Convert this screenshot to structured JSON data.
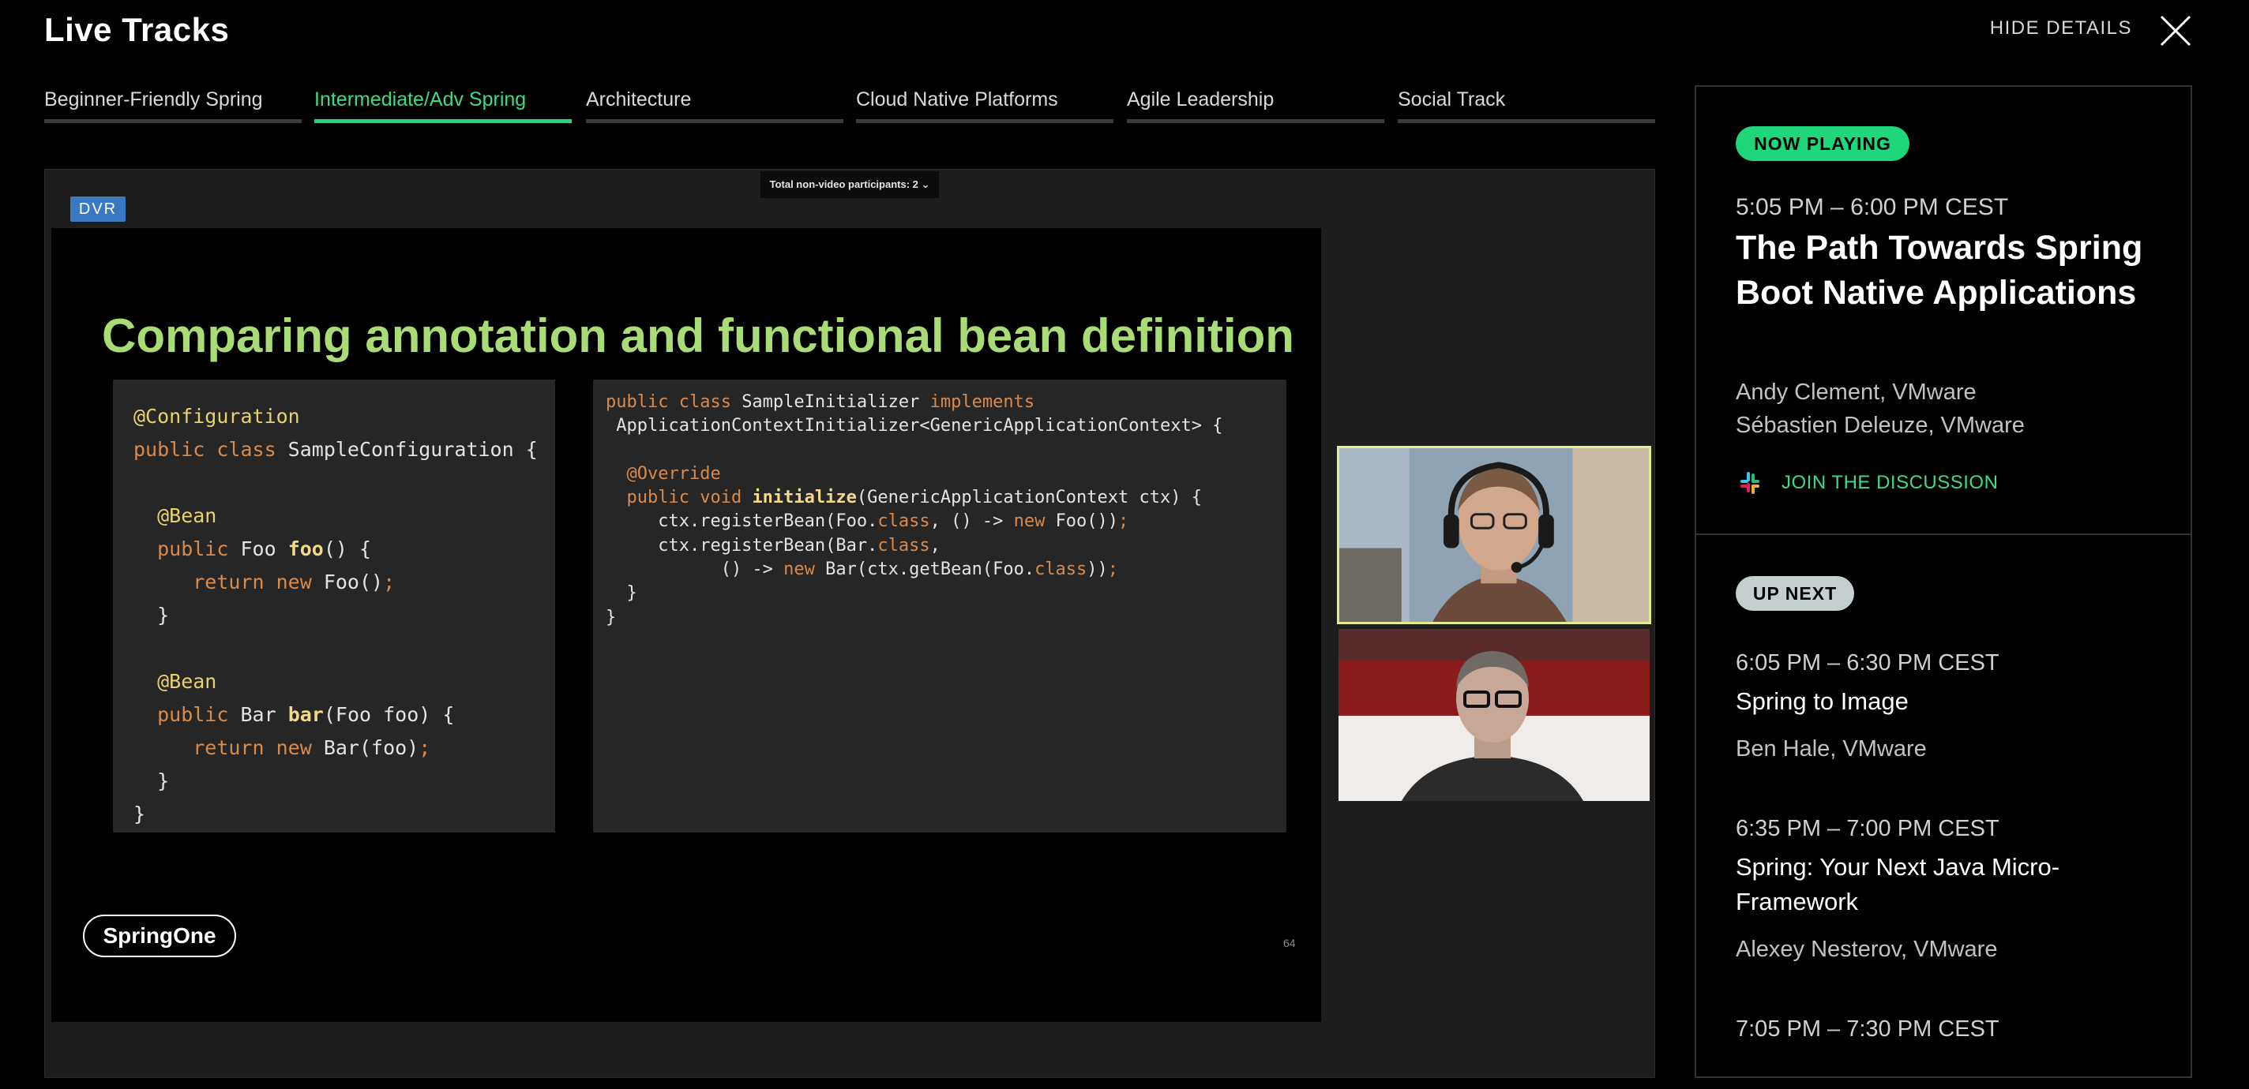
{
  "app": {
    "title": "Live Tracks"
  },
  "header": {
    "hide_details_label": "HIDE DETAILS",
    "close_icon": "close-icon"
  },
  "tabs": [
    {
      "label": "Beginner-Friendly Spring",
      "active": false
    },
    {
      "label": "Intermediate/Adv Spring",
      "active": true
    },
    {
      "label": "Architecture",
      "active": false
    },
    {
      "label": "Cloud Native Platforms",
      "active": false
    },
    {
      "label": "Agile Leadership",
      "active": false
    },
    {
      "label": "Social Track",
      "active": false
    }
  ],
  "player": {
    "participants_label": "Total non-video participants: 2 ⌄",
    "dvr_label": "DVR",
    "slide": {
      "title": "Comparing annotation and functional bean definition",
      "code_left": [
        [
          [
            "@Configuration",
            "ann"
          ]
        ],
        [
          [
            "public class ",
            "kw"
          ],
          [
            "SampleConfiguration {",
            "tx"
          ]
        ],
        [
          [
            "",
            "tx"
          ]
        ],
        [
          [
            "  @Bean",
            "ann"
          ]
        ],
        [
          [
            "  public ",
            "kw"
          ],
          [
            "Foo ",
            "tx"
          ],
          [
            "foo",
            "fn"
          ],
          [
            "() {",
            "tx"
          ]
        ],
        [
          [
            "     return new ",
            "kw"
          ],
          [
            "Foo()",
            "tx"
          ],
          [
            ";",
            "kw"
          ]
        ],
        [
          [
            "  }",
            "tx"
          ]
        ],
        [
          [
            "",
            "tx"
          ]
        ],
        [
          [
            "  @Bean",
            "ann"
          ]
        ],
        [
          [
            "  public ",
            "kw"
          ],
          [
            "Bar ",
            "tx"
          ],
          [
            "bar",
            "fn"
          ],
          [
            "(Foo foo) {",
            "tx"
          ]
        ],
        [
          [
            "     return new ",
            "kw"
          ],
          [
            "Bar(foo)",
            "tx"
          ],
          [
            ";",
            "kw"
          ]
        ],
        [
          [
            "  }",
            "tx"
          ]
        ],
        [
          [
            "}",
            "tx"
          ]
        ]
      ],
      "code_right": [
        [
          [
            "public class ",
            "kw"
          ],
          [
            "SampleInitializer ",
            "tx"
          ],
          [
            "implements",
            "kw"
          ]
        ],
        [
          [
            " ApplicationContextInitializer<GenericApplicationContext> {",
            "tx"
          ]
        ],
        [
          [
            "",
            "tx"
          ]
        ],
        [
          [
            "  @Override",
            "kw"
          ]
        ],
        [
          [
            "  public void ",
            "kw"
          ],
          [
            "initialize",
            "fn"
          ],
          [
            "(GenericApplicationContext ctx) {",
            "tx"
          ]
        ],
        [
          [
            "     ctx.registerBean(Foo.",
            "tx"
          ],
          [
            "class",
            "kw"
          ],
          [
            ", () -> ",
            "tx"
          ],
          [
            "new ",
            "kw"
          ],
          [
            "Foo())",
            "tx"
          ],
          [
            ";",
            "kw"
          ]
        ],
        [
          [
            "     ctx.registerBean(Bar.",
            "tx"
          ],
          [
            "class",
            "kw"
          ],
          [
            ",",
            "tx"
          ]
        ],
        [
          [
            "           () -> ",
            "tx"
          ],
          [
            "new ",
            "kw"
          ],
          [
            "Bar(ctx.getBean(Foo.",
            "tx"
          ],
          [
            "class",
            "kw"
          ],
          [
            "))",
            "tx"
          ],
          [
            ";",
            "kw"
          ]
        ],
        [
          [
            "  }",
            "tx"
          ]
        ],
        [
          [
            "}",
            "tx"
          ]
        ]
      ],
      "logo_text": "SpringOne",
      "page_number": "64"
    }
  },
  "now_playing": {
    "badge": "NOW PLAYING",
    "time": "5:05 PM – 6:00 PM CEST",
    "title": "The Path Towards Spring Boot Native Applications",
    "speakers": [
      "Andy Clement, VMware",
      "Sébastien Deleuze, VMware"
    ],
    "discussion_label": "JOIN THE DISCUSSION",
    "discussion_icon": "slack-icon"
  },
  "up_next": {
    "badge": "UP NEXT",
    "items": [
      {
        "time": "6:05 PM – 6:30 PM CEST",
        "title": "Spring to Image",
        "speaker": "Ben Hale, VMware"
      },
      {
        "time": "6:35 PM – 7:00 PM CEST",
        "title": "Spring: Your Next Java Micro-Framework",
        "speaker": "Alexey Nesterov, VMware"
      },
      {
        "time": "7:05 PM – 7:30 PM CEST",
        "title": "",
        "speaker": ""
      }
    ]
  },
  "colors": {
    "accent_green": "#1fd67a",
    "slide_title": "#a9dc76",
    "dvr_blue": "#3a78c2",
    "active_speaker_border": "#e2ee8c"
  }
}
